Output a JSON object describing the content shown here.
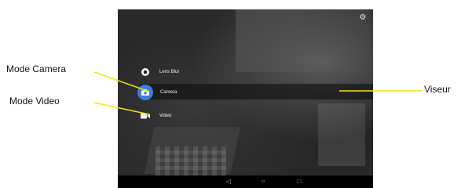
{
  "annotations": {
    "mode_camera": "Mode Camera",
    "mode_video": "Mode Video",
    "viseur": "Viseur"
  },
  "camera_app": {
    "modes": [
      {
        "label": "Lens Blur",
        "icon": "lens-blur-icon"
      },
      {
        "label": "Camera",
        "icon": "camera-icon",
        "selected": true
      },
      {
        "label": "Video",
        "icon": "video-icon"
      }
    ],
    "settings_icon": "gear-icon",
    "accent_color": "#3b7fe0"
  },
  "navigation_bar": {
    "buttons": [
      "back-icon",
      "home-icon",
      "recent-apps-icon"
    ]
  },
  "leader_line_color": "#f2e600"
}
